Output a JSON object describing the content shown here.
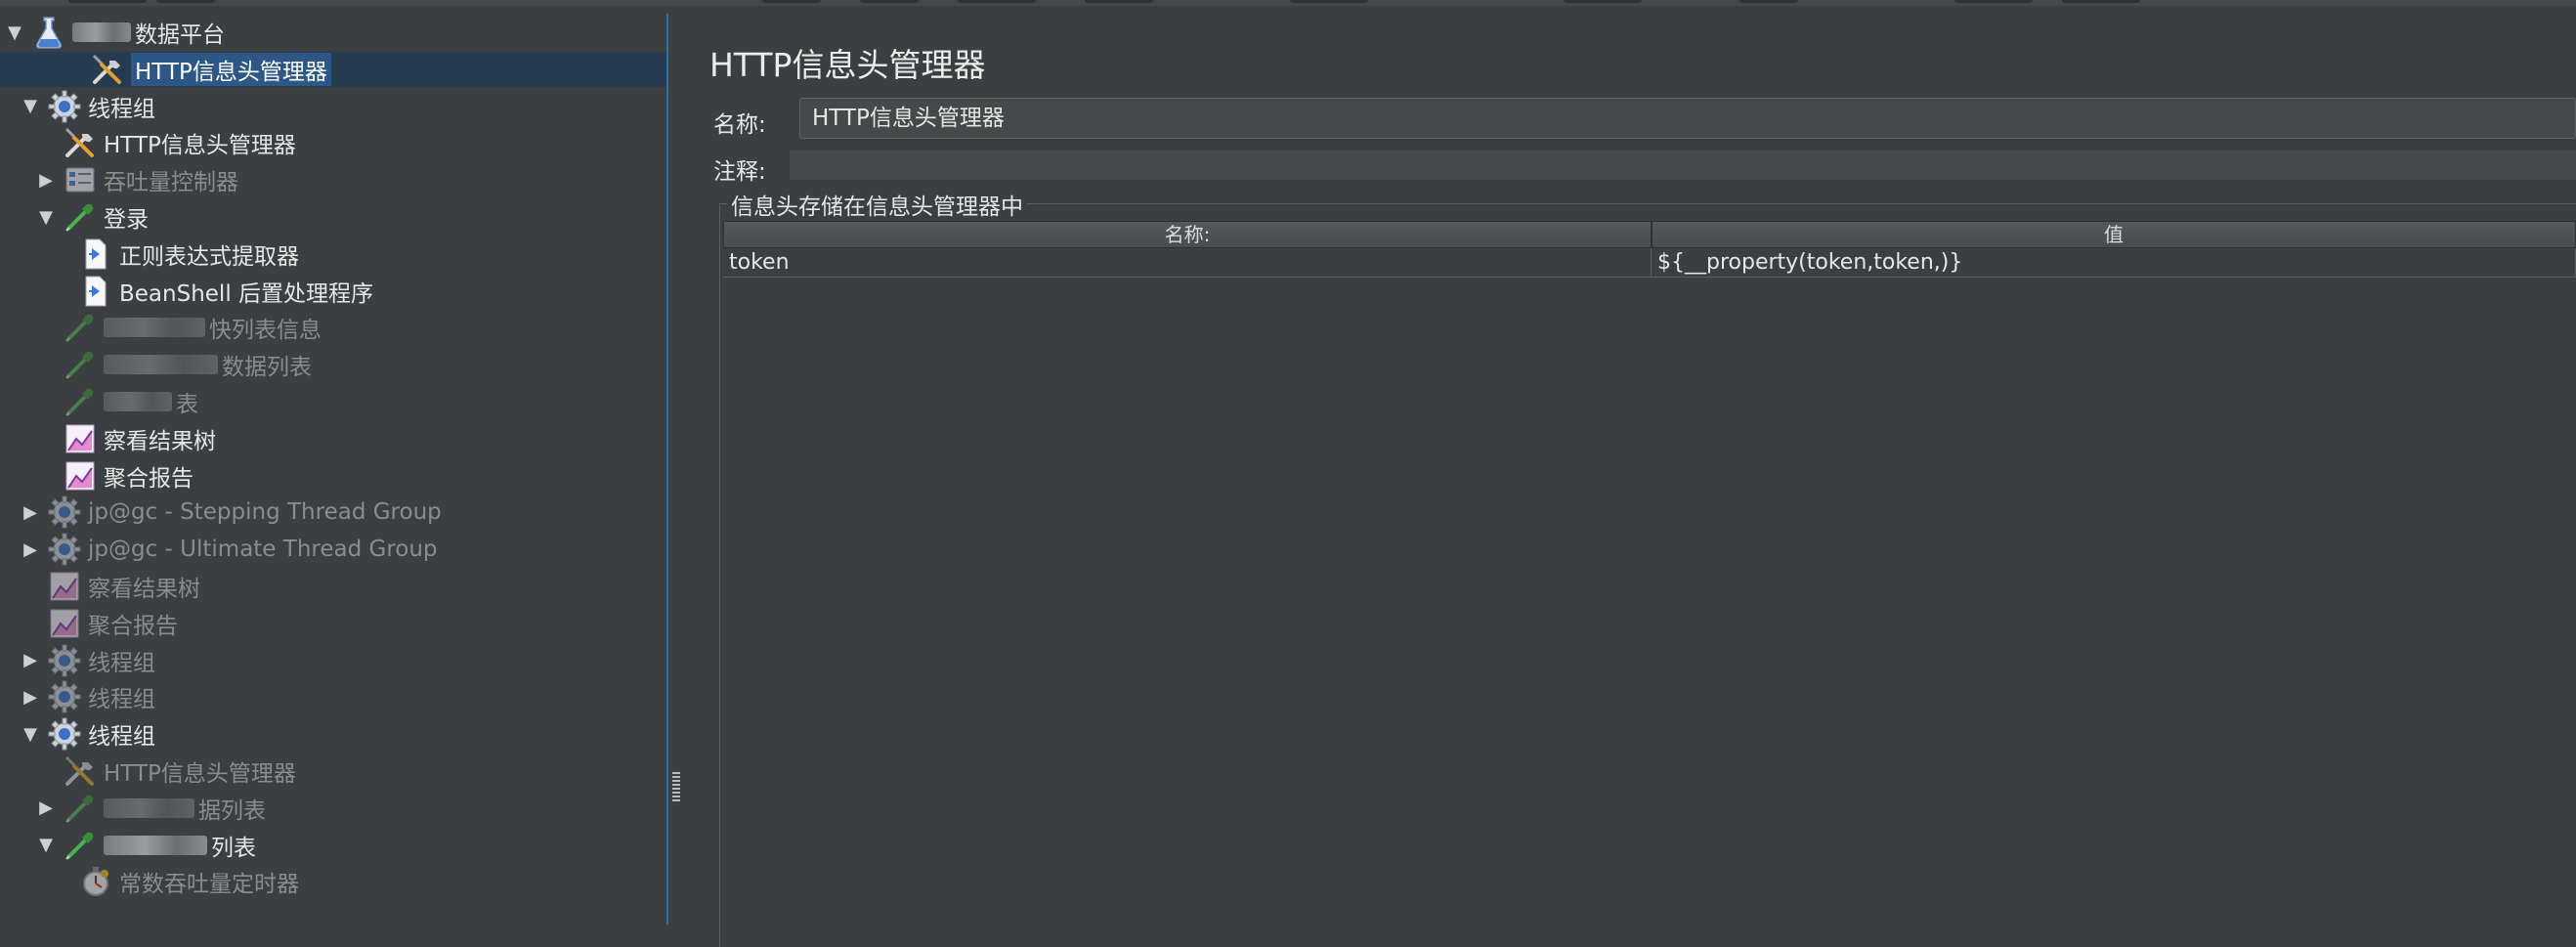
{
  "tree": {
    "items": [
      {
        "label": "数据平台",
        "icon": "flask-icon",
        "toggle": "open",
        "state": "normal",
        "blurred": true
      },
      {
        "label": "HTTP信息头管理器",
        "icon": "wrench-screwdriver-icon",
        "toggle": "",
        "state": "selected",
        "blurred": false
      },
      {
        "label": "线程组",
        "icon": "gear-icon",
        "toggle": "open",
        "state": "normal",
        "blurred": false
      },
      {
        "label": "HTTP信息头管理器",
        "icon": "wrench-screwdriver-icon",
        "toggle": "",
        "state": "normal",
        "blurred": false
      },
      {
        "label": "吞吐量控制器",
        "icon": "controller-icon",
        "toggle": "closed",
        "state": "disabled",
        "blurred": false
      },
      {
        "label": "登录",
        "icon": "pipette-icon",
        "toggle": "open",
        "state": "normal",
        "blurred": false
      },
      {
        "label": "正则表达式提取器",
        "icon": "document-arrow-icon",
        "toggle": "",
        "state": "normal",
        "blurred": false
      },
      {
        "label": "BeanShell 后置处理程序",
        "icon": "document-arrow-icon",
        "toggle": "",
        "state": "normal",
        "blurred": false
      },
      {
        "label": "快列表信息",
        "icon": "pipette-icon",
        "toggle": "",
        "state": "disabled",
        "blurred": true
      },
      {
        "label": "数据列表",
        "icon": "pipette-icon",
        "toggle": "",
        "state": "disabled",
        "blurred": true
      },
      {
        "label": "表",
        "icon": "pipette-icon",
        "toggle": "",
        "state": "disabled",
        "blurred": true
      },
      {
        "label": "察看结果树",
        "icon": "graph-icon",
        "toggle": "",
        "state": "normal",
        "blurred": false
      },
      {
        "label": "聚合报告",
        "icon": "graph-icon",
        "toggle": "",
        "state": "normal",
        "blurred": false
      },
      {
        "label": "jp@gc - Stepping Thread Group",
        "icon": "gear-icon",
        "toggle": "closed",
        "state": "disabled",
        "blurred": false
      },
      {
        "label": "jp@gc - Ultimate Thread Group",
        "icon": "gear-icon",
        "toggle": "closed",
        "state": "disabled",
        "blurred": false
      },
      {
        "label": "察看结果树",
        "icon": "graph-icon",
        "toggle": "",
        "state": "disabled",
        "blurred": false
      },
      {
        "label": "聚合报告",
        "icon": "graph-icon",
        "toggle": "",
        "state": "disabled",
        "blurred": false
      },
      {
        "label": "线程组",
        "icon": "gear-icon",
        "toggle": "closed",
        "state": "disabled",
        "blurred": false
      },
      {
        "label": "线程组",
        "icon": "gear-icon",
        "toggle": "closed",
        "state": "disabled",
        "blurred": false
      },
      {
        "label": "线程组",
        "icon": "gear-icon",
        "toggle": "open",
        "state": "normal",
        "blurred": false
      },
      {
        "label": "HTTP信息头管理器",
        "icon": "wrench-screwdriver-icon",
        "toggle": "",
        "state": "disabled",
        "blurred": false
      },
      {
        "label": "据列表",
        "icon": "pipette-icon",
        "toggle": "closed",
        "state": "disabled",
        "blurred": true
      },
      {
        "label": "列表",
        "icon": "pipette-icon",
        "toggle": "open",
        "state": "normal",
        "blurred": true
      },
      {
        "label": "常数吞吐量定时器",
        "icon": "stopwatch-icon",
        "toggle": "",
        "state": "disabled",
        "blurred": false
      }
    ]
  },
  "panel": {
    "title": "HTTP信息头管理器",
    "name_label": "名称:",
    "name_value": "HTTP信息头管理器",
    "comment_label": "注释:",
    "comment_value": "",
    "group_title": "信息头存储在信息头管理器中",
    "table": {
      "columns": [
        "名称:",
        "值"
      ],
      "rows": [
        {
          "name": "token",
          "value": "${__property(token,token,)}"
        }
      ]
    }
  },
  "colors": {
    "background": "#3c3f41",
    "selection": "#2d5786",
    "accent_border": "#2f6fa3"
  }
}
